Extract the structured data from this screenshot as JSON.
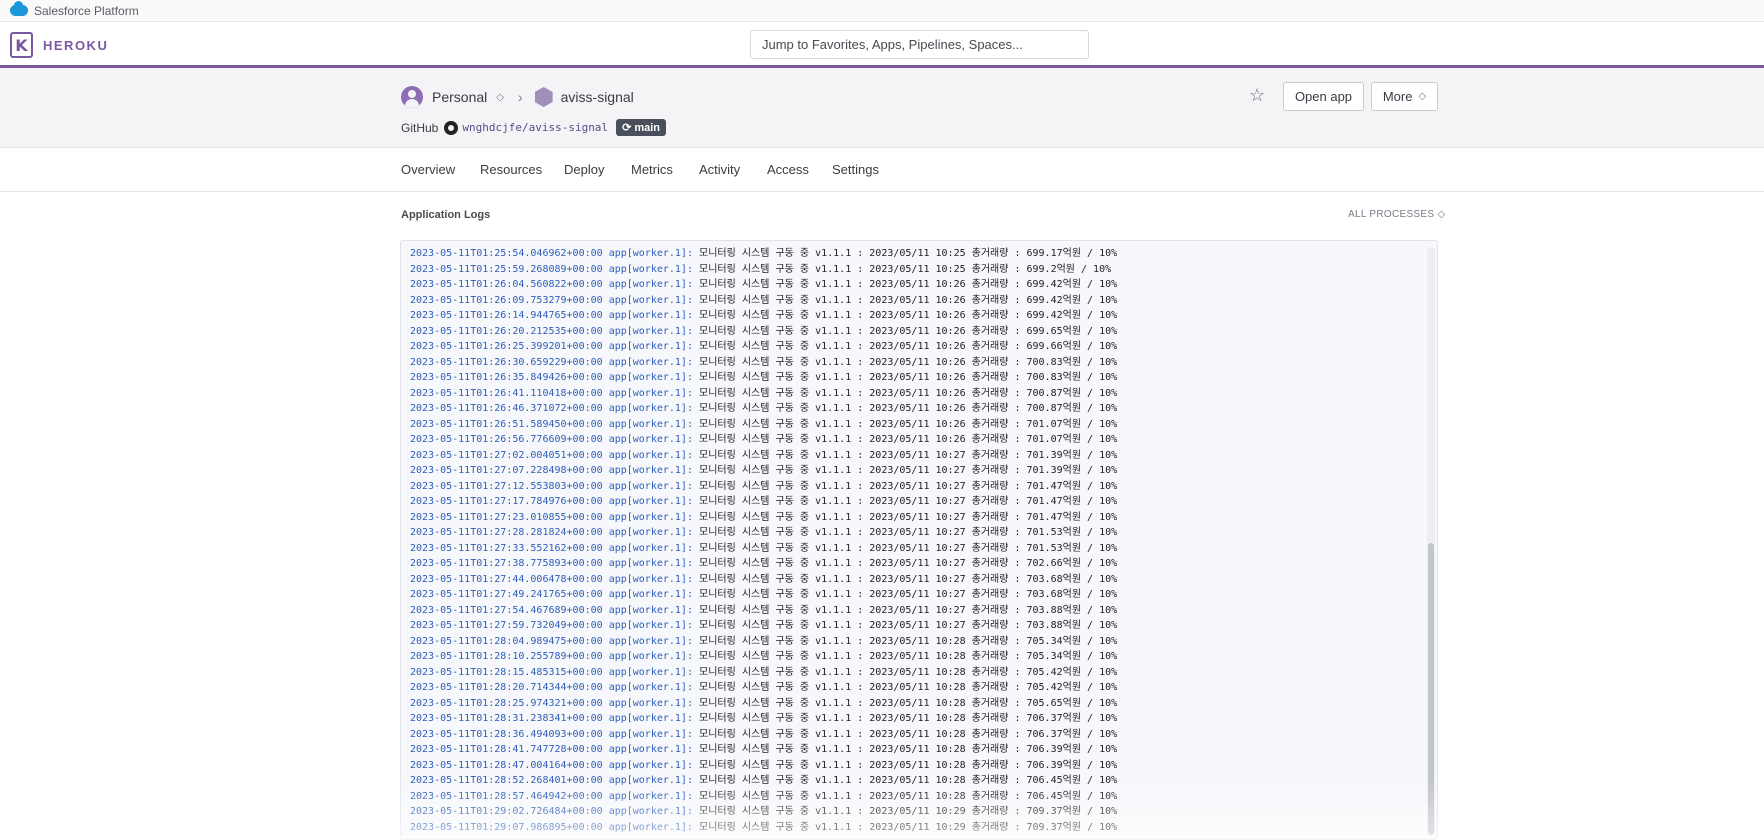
{
  "platform_bar": {
    "label": "Salesforce Platform"
  },
  "header": {
    "brand": "HEROKU",
    "search_placeholder": "Jump to Favorites, Apps, Pipelines, Spaces..."
  },
  "app": {
    "account": "Personal",
    "name": "aviss-signal",
    "github_label": "GitHub",
    "repo": "wnghdcjfe/aviss-signal",
    "branch": "main",
    "open_app_label": "Open app",
    "more_label": "More"
  },
  "tabs": [
    "Overview",
    "Resources",
    "Deploy",
    "Metrics",
    "Activity",
    "Access",
    "Settings"
  ],
  "logs": {
    "title": "Application Logs",
    "process_filter": "ALL PROCESSES",
    "lines": [
      {
        "ts": "2023-05-11T01:25:54.046962+00:00",
        "src": "app[worker.1]:",
        "msg": "모니터링 시스템 구동 중 v1.1.1 : 2023/05/11 10:25 총거래량 : 699.17억원 / 10%"
      },
      {
        "ts": "2023-05-11T01:25:59.268089+00:00",
        "src": "app[worker.1]:",
        "msg": "모니터링 시스템 구동 중 v1.1.1 : 2023/05/11 10:25 총거래량 : 699.2억원 / 10%"
      },
      {
        "ts": "2023-05-11T01:26:04.560822+00:00",
        "src": "app[worker.1]:",
        "msg": "모니터링 시스템 구동 중 v1.1.1 : 2023/05/11 10:26 총거래량 : 699.42억원 / 10%"
      },
      {
        "ts": "2023-05-11T01:26:09.753279+00:00",
        "src": "app[worker.1]:",
        "msg": "모니터링 시스템 구동 중 v1.1.1 : 2023/05/11 10:26 총거래량 : 699.42억원 / 10%"
      },
      {
        "ts": "2023-05-11T01:26:14.944765+00:00",
        "src": "app[worker.1]:",
        "msg": "모니터링 시스템 구동 중 v1.1.1 : 2023/05/11 10:26 총거래량 : 699.42억원 / 10%"
      },
      {
        "ts": "2023-05-11T01:26:20.212535+00:00",
        "src": "app[worker.1]:",
        "msg": "모니터링 시스템 구동 중 v1.1.1 : 2023/05/11 10:26 총거래량 : 699.65억원 / 10%"
      },
      {
        "ts": "2023-05-11T01:26:25.399201+00:00",
        "src": "app[worker.1]:",
        "msg": "모니터링 시스템 구동 중 v1.1.1 : 2023/05/11 10:26 총거래량 : 699.66억원 / 10%"
      },
      {
        "ts": "2023-05-11T01:26:30.659229+00:00",
        "src": "app[worker.1]:",
        "msg": "모니터링 시스템 구동 중 v1.1.1 : 2023/05/11 10:26 총거래량 : 700.83억원 / 10%"
      },
      {
        "ts": "2023-05-11T01:26:35.849426+00:00",
        "src": "app[worker.1]:",
        "msg": "모니터링 시스템 구동 중 v1.1.1 : 2023/05/11 10:26 총거래량 : 700.83억원 / 10%"
      },
      {
        "ts": "2023-05-11T01:26:41.110418+00:00",
        "src": "app[worker.1]:",
        "msg": "모니터링 시스템 구동 중 v1.1.1 : 2023/05/11 10:26 총거래량 : 700.87억원 / 10%"
      },
      {
        "ts": "2023-05-11T01:26:46.371072+00:00",
        "src": "app[worker.1]:",
        "msg": "모니터링 시스템 구동 중 v1.1.1 : 2023/05/11 10:26 총거래량 : 700.87억원 / 10%"
      },
      {
        "ts": "2023-05-11T01:26:51.589450+00:00",
        "src": "app[worker.1]:",
        "msg": "모니터링 시스템 구동 중 v1.1.1 : 2023/05/11 10:26 총거래량 : 701.07억원 / 10%"
      },
      {
        "ts": "2023-05-11T01:26:56.776609+00:00",
        "src": "app[worker.1]:",
        "msg": "모니터링 시스템 구동 중 v1.1.1 : 2023/05/11 10:26 총거래량 : 701.07억원 / 10%"
      },
      {
        "ts": "2023-05-11T01:27:02.004051+00:00",
        "src": "app[worker.1]:",
        "msg": "모니터링 시스템 구동 중 v1.1.1 : 2023/05/11 10:27 총거래량 : 701.39억원 / 10%"
      },
      {
        "ts": "2023-05-11T01:27:07.228498+00:00",
        "src": "app[worker.1]:",
        "msg": "모니터링 시스템 구동 중 v1.1.1 : 2023/05/11 10:27 총거래량 : 701.39억원 / 10%"
      },
      {
        "ts": "2023-05-11T01:27:12.553803+00:00",
        "src": "app[worker.1]:",
        "msg": "모니터링 시스템 구동 중 v1.1.1 : 2023/05/11 10:27 총거래량 : 701.47억원 / 10%"
      },
      {
        "ts": "2023-05-11T01:27:17.784976+00:00",
        "src": "app[worker.1]:",
        "msg": "모니터링 시스템 구동 중 v1.1.1 : 2023/05/11 10:27 총거래량 : 701.47억원 / 10%"
      },
      {
        "ts": "2023-05-11T01:27:23.010855+00:00",
        "src": "app[worker.1]:",
        "msg": "모니터링 시스템 구동 중 v1.1.1 : 2023/05/11 10:27 총거래량 : 701.47억원 / 10%"
      },
      {
        "ts": "2023-05-11T01:27:28.281824+00:00",
        "src": "app[worker.1]:",
        "msg": "모니터링 시스템 구동 중 v1.1.1 : 2023/05/11 10:27 총거래량 : 701.53억원 / 10%"
      },
      {
        "ts": "2023-05-11T01:27:33.552162+00:00",
        "src": "app[worker.1]:",
        "msg": "모니터링 시스템 구동 중 v1.1.1 : 2023/05/11 10:27 총거래량 : 701.53억원 / 10%"
      },
      {
        "ts": "2023-05-11T01:27:38.775893+00:00",
        "src": "app[worker.1]:",
        "msg": "모니터링 시스템 구동 중 v1.1.1 : 2023/05/11 10:27 총거래량 : 702.66억원 / 10%"
      },
      {
        "ts": "2023-05-11T01:27:44.006478+00:00",
        "src": "app[worker.1]:",
        "msg": "모니터링 시스템 구동 중 v1.1.1 : 2023/05/11 10:27 총거래량 : 703.68억원 / 10%"
      },
      {
        "ts": "2023-05-11T01:27:49.241765+00:00",
        "src": "app[worker.1]:",
        "msg": "모니터링 시스템 구동 중 v1.1.1 : 2023/05/11 10:27 총거래량 : 703.68억원 / 10%"
      },
      {
        "ts": "2023-05-11T01:27:54.467689+00:00",
        "src": "app[worker.1]:",
        "msg": "모니터링 시스템 구동 중 v1.1.1 : 2023/05/11 10:27 총거래량 : 703.88억원 / 10%"
      },
      {
        "ts": "2023-05-11T01:27:59.732049+00:00",
        "src": "app[worker.1]:",
        "msg": "모니터링 시스템 구동 중 v1.1.1 : 2023/05/11 10:27 총거래량 : 703.88억원 / 10%"
      },
      {
        "ts": "2023-05-11T01:28:04.989475+00:00",
        "src": "app[worker.1]:",
        "msg": "모니터링 시스템 구동 중 v1.1.1 : 2023/05/11 10:28 총거래량 : 705.34억원 / 10%"
      },
      {
        "ts": "2023-05-11T01:28:10.255789+00:00",
        "src": "app[worker.1]:",
        "msg": "모니터링 시스템 구동 중 v1.1.1 : 2023/05/11 10:28 총거래량 : 705.34억원 / 10%"
      },
      {
        "ts": "2023-05-11T01:28:15.485315+00:00",
        "src": "app[worker.1]:",
        "msg": "모니터링 시스템 구동 중 v1.1.1 : 2023/05/11 10:28 총거래량 : 705.42억원 / 10%"
      },
      {
        "ts": "2023-05-11T01:28:20.714344+00:00",
        "src": "app[worker.1]:",
        "msg": "모니터링 시스템 구동 중 v1.1.1 : 2023/05/11 10:28 총거래량 : 705.42억원 / 10%"
      },
      {
        "ts": "2023-05-11T01:28:25.974321+00:00",
        "src": "app[worker.1]:",
        "msg": "모니터링 시스템 구동 중 v1.1.1 : 2023/05/11 10:28 총거래량 : 705.65억원 / 10%"
      },
      {
        "ts": "2023-05-11T01:28:31.238341+00:00",
        "src": "app[worker.1]:",
        "msg": "모니터링 시스템 구동 중 v1.1.1 : 2023/05/11 10:28 총거래량 : 706.37억원 / 10%"
      },
      {
        "ts": "2023-05-11T01:28:36.494093+00:00",
        "src": "app[worker.1]:",
        "msg": "모니터링 시스템 구동 중 v1.1.1 : 2023/05/11 10:28 총거래량 : 706.37억원 / 10%"
      },
      {
        "ts": "2023-05-11T01:28:41.747728+00:00",
        "src": "app[worker.1]:",
        "msg": "모니터링 시스템 구동 중 v1.1.1 : 2023/05/11 10:28 총거래량 : 706.39억원 / 10%"
      },
      {
        "ts": "2023-05-11T01:28:47.004164+00:00",
        "src": "app[worker.1]:",
        "msg": "모니터링 시스템 구동 중 v1.1.1 : 2023/05/11 10:28 총거래량 : 706.39억원 / 10%"
      },
      {
        "ts": "2023-05-11T01:28:52.268401+00:00",
        "src": "app[worker.1]:",
        "msg": "모니터링 시스템 구동 중 v1.1.1 : 2023/05/11 10:28 총거래량 : 706.45억원 / 10%"
      },
      {
        "ts": "2023-05-11T01:28:57.464942+00:00",
        "src": "app[worker.1]:",
        "msg": "모니터링 시스템 구동 중 v1.1.1 : 2023/05/11 10:28 총거래량 : 706.45억원 / 10%"
      },
      {
        "ts": "2023-05-11T01:29:02.726484+00:00",
        "src": "app[worker.1]:",
        "msg": "모니터링 시스템 구동 중 v1.1.1 : 2023/05/11 10:29 총거래량 : 709.37억원 / 10%"
      },
      {
        "ts": "2023-05-11T01:29:07.986895+00:00",
        "src": "app[worker.1]:",
        "msg": "모니터링 시스템 구동 중 v1.1.1 : 2023/05/11 10:29 총거래량 : 709.37억원 / 10%"
      }
    ]
  },
  "colors": {
    "brand": "#79589f",
    "log_timestamp": "#2f5eb8",
    "log_background": "#f7f8fb"
  },
  "icons": [
    "salesforce-cloud-icon",
    "heroku-logo-icon",
    "user-avatar-icon",
    "hexagon-app-icon",
    "github-icon",
    "branch-sync-icon",
    "star-icon",
    "updown-chevron-icon"
  ]
}
